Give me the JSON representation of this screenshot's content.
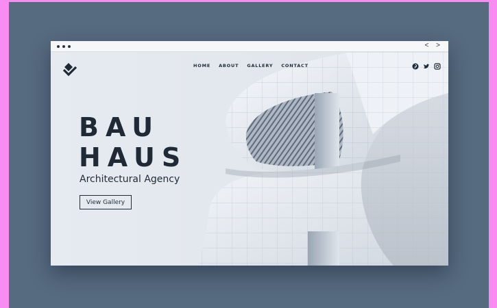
{
  "nav": {
    "items": [
      "HOME",
      "ABOUT",
      "GALLERY",
      "CONTACT"
    ]
  },
  "browser": {
    "nav_arrows": "< >"
  },
  "social": [
    "pinterest-icon",
    "twitter-icon",
    "instagram-icon"
  ],
  "hero": {
    "title_line1": "BAU",
    "title_line2": "HAUS",
    "subtitle": "Architectural Agency",
    "cta": "View Gallery"
  },
  "colors": {
    "ink": "#1f2a36",
    "backdrop": "#566a80",
    "frame": "#f88cf0"
  }
}
